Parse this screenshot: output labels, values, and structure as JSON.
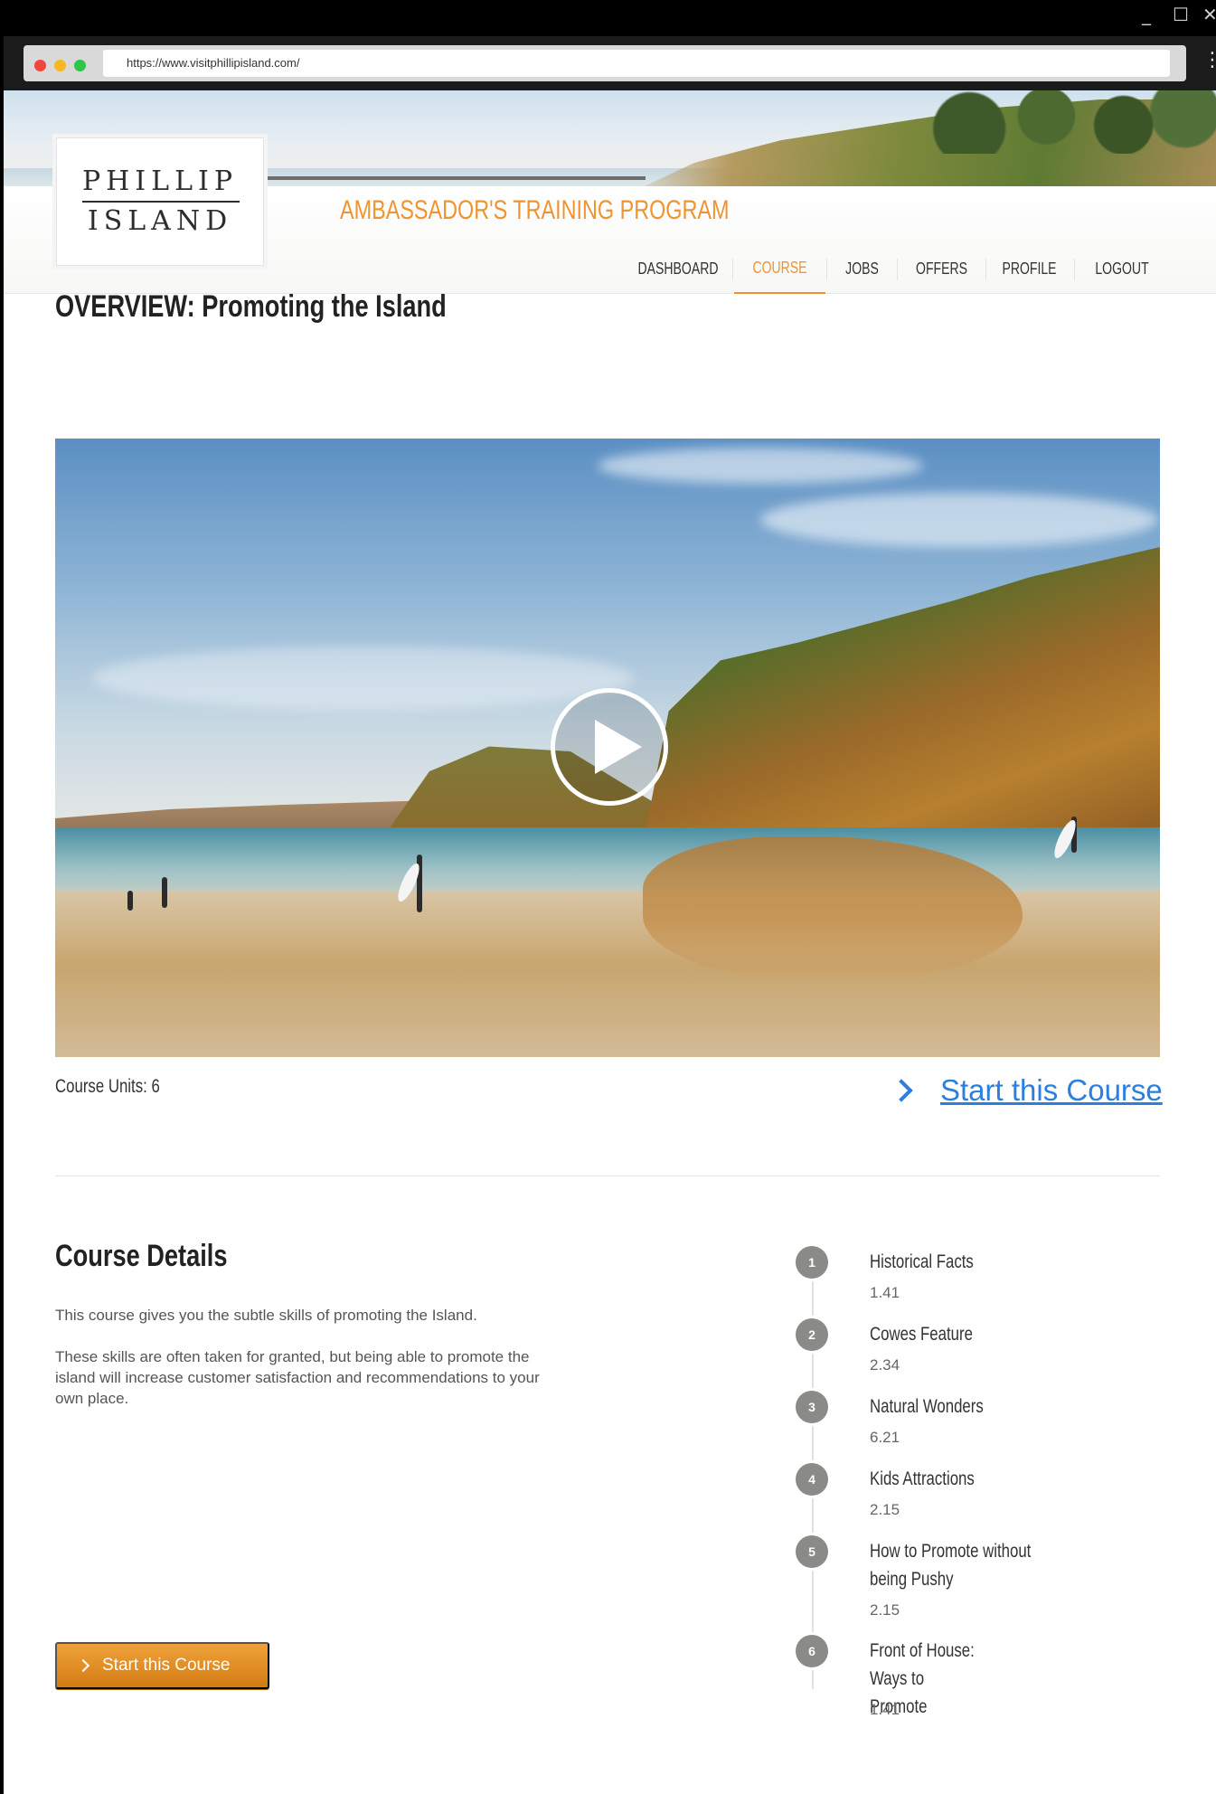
{
  "browser": {
    "url": "https://www.visitphillipisland.com/"
  },
  "logo": {
    "line1": "PHILLIP",
    "line2": "ISLAND"
  },
  "header": {
    "program_title": "AMBASSADOR'S TRAINING PROGRAM"
  },
  "nav": {
    "items": [
      {
        "label": "DASHBOARD"
      },
      {
        "label": "COURSE"
      },
      {
        "label": "JOBS"
      },
      {
        "label": "OFFERS"
      },
      {
        "label": "PROFILE"
      },
      {
        "label": "LOGOUT"
      }
    ],
    "active": "COURSE"
  },
  "overview": {
    "title": "OVERVIEW: Promoting the Island",
    "course_units_label": "Course Units:",
    "course_units_value": "6",
    "start_link": "Start this Course"
  },
  "details": {
    "title": "Course Details",
    "paragraph1": "This course gives you the subtle skills of promoting the Island.",
    "paragraph2": "These skills are often taken for granted, but being able to promote the island will increase customer satisfaction and recommendations to your own place.",
    "start_button": "Start this Course"
  },
  "units": [
    {
      "num": "1",
      "name": "Historical Facts",
      "duration": "1.41"
    },
    {
      "num": "2",
      "name": "Cowes Feature",
      "duration": "2.34"
    },
    {
      "num": "3",
      "name": "Natural Wonders",
      "duration": "6.21"
    },
    {
      "num": "4",
      "name": "Kids Attractions",
      "duration": "2.15"
    },
    {
      "num": "5",
      "name": "How to Promote without being Pushy",
      "duration": "2.15"
    },
    {
      "num": "6",
      "name": "Front of House: Ways to Promote",
      "duration": "1.41"
    }
  ],
  "colors": {
    "accent_orange": "#ef9430",
    "link_blue": "#2a7fe0",
    "button_orange": "#e08a1e"
  },
  "icons": {
    "play": "play-icon",
    "chevron": "chevron-right-icon"
  }
}
